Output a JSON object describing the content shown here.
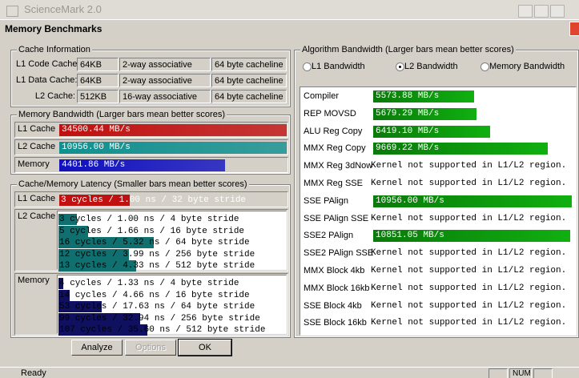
{
  "background_window": {
    "title": "ScienceMark 2.0"
  },
  "dialog": {
    "title": "Memory Benchmarks"
  },
  "cache_info": {
    "legend": "Cache Information",
    "rows": [
      {
        "label": "L1 Code Cache:",
        "size": "64KB",
        "assoc": "2-way associative",
        "line": "64 byte cacheline"
      },
      {
        "label": "L1 Data Cache:",
        "size": "64KB",
        "assoc": "2-way associative",
        "line": "64 byte cacheline"
      },
      {
        "label": "L2 Cache:",
        "size": "512KB",
        "assoc": "16-way associative",
        "line": "64 byte cacheline"
      }
    ]
  },
  "mem_bandwidth": {
    "legend": "Memory Bandwidth (Larger bars mean better scores)",
    "rows": [
      {
        "label": "L1 Cache",
        "value": "34500.44 MB/s",
        "fraction": 1.0,
        "color": "#c01010"
      },
      {
        "label": "L2 Cache",
        "value": "10956.00 MB/s",
        "fraction": 1.0,
        "color": "#109090"
      },
      {
        "label": "Memory",
        "value": "4401.86 MB/s",
        "fraction": 0.73,
        "color": "#1010c0"
      }
    ]
  },
  "latency": {
    "legend": "Cache/Memory Latency (Smaller bars mean better scores)",
    "l1": {
      "label": "L1 Cache",
      "text": "3 cycles / 1.00 ns / 32 byte stride",
      "fraction": 0.31,
      "color": "#c01010"
    },
    "l2": {
      "label": "L2 Cache",
      "color": "#107070",
      "rows": [
        {
          "text": "3 cycles / 1.00 ns / 4 byte stride",
          "fraction": 0.08
        },
        {
          "text": "5 cycles / 1.66 ns / 16 byte stride",
          "fraction": 0.13
        },
        {
          "text": "16 cycles / 5.32 ns / 64 byte stride",
          "fraction": 0.42
        },
        {
          "text": "12 cycles / 3.99 ns / 256 byte stride",
          "fraction": 0.31
        },
        {
          "text": "13 cycles / 4.33 ns / 512 byte stride",
          "fraction": 0.34
        }
      ]
    },
    "mem": {
      "label": "Memory",
      "color": "#101060",
      "rows": [
        {
          "text": "4 cycles / 1.33 ns / 4 byte stride",
          "fraction": 0.02
        },
        {
          "text": "14 cycles / 4.66 ns / 16 byte stride",
          "fraction": 0.05
        },
        {
          "text": "53 cycles / 17.63 ns / 64 byte stride",
          "fraction": 0.19
        },
        {
          "text": "99 cycles / 32.94 ns / 256 byte stride",
          "fraction": 0.36
        },
        {
          "text": "107 cycles / 35.60 ns / 512 byte stride",
          "fraction": 0.39
        }
      ]
    }
  },
  "algorithm": {
    "legend": "Algorithm Bandwidth (Larger bars mean better scores)",
    "radios": [
      {
        "label": "L1 Bandwidth",
        "selected": false
      },
      {
        "label": "L2 Bandwidth",
        "selected": true
      },
      {
        "label": "Memory Bandwidth",
        "selected": false
      }
    ],
    "color": "#10b010",
    "rows": [
      {
        "name": "Compiler",
        "value": "5573.88 MB/s",
        "fraction": 0.51
      },
      {
        "name": "REP MOVSD",
        "value": "5679.29 MB/s",
        "fraction": 0.52
      },
      {
        "name": "ALU Reg Copy",
        "value": "6419.10 MB/s",
        "fraction": 0.59
      },
      {
        "name": "MMX Reg Copy",
        "value": "9669.22 MB/s",
        "fraction": 0.88
      },
      {
        "name": "MMX Reg 3dNow",
        "value": "Kernel not supported in L1/L2 region.",
        "fraction": 0
      },
      {
        "name": "MMX Reg SSE",
        "value": "Kernel not supported in L1/L2 region.",
        "fraction": 0
      },
      {
        "name": "SSE PAlign",
        "value": "10956.00 MB/s",
        "fraction": 1.0
      },
      {
        "name": "SSE PAlign SSE",
        "value": "Kernel not supported in L1/L2 region.",
        "fraction": 0
      },
      {
        "name": "SSE2 PAlign",
        "value": "10851.05 MB/s",
        "fraction": 0.99
      },
      {
        "name": "SSE2 PAlign SSE",
        "value": "Kernel not supported in L1/L2 region.",
        "fraction": 0
      },
      {
        "name": "MMX Block 4kb",
        "value": "Kernel not supported in L1/L2 region.",
        "fraction": 0
      },
      {
        "name": "MMX Block 16kb",
        "value": "Kernel not supported in L1/L2 region.",
        "fraction": 0
      },
      {
        "name": "SSE Block 4kb",
        "value": "Kernel not supported in L1/L2 region.",
        "fraction": 0
      },
      {
        "name": "SSE Block 16kb",
        "value": "Kernel not supported in L1/L2 region.",
        "fraction": 0
      }
    ]
  },
  "buttons": {
    "analyze": "Analyze",
    "options": "Options",
    "ok": "OK"
  },
  "status": {
    "text": "Ready",
    "num": "NUM"
  }
}
